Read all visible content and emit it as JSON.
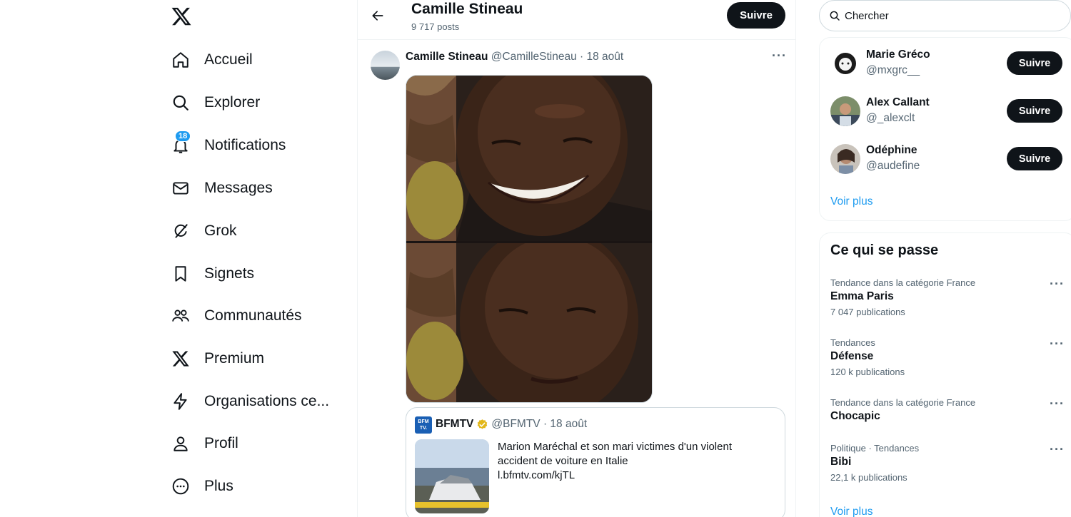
{
  "nav": {
    "items": [
      {
        "label": "Accueil",
        "icon": "home-icon"
      },
      {
        "label": "Explorer",
        "icon": "search-icon"
      },
      {
        "label": "Notifications",
        "icon": "bell-icon",
        "badge": "18"
      },
      {
        "label": "Messages",
        "icon": "mail-icon"
      },
      {
        "label": "Grok",
        "icon": "grok-icon"
      },
      {
        "label": "Signets",
        "icon": "bookmark-icon"
      },
      {
        "label": "Communautés",
        "icon": "communities-icon"
      },
      {
        "label": "Premium",
        "icon": "x-logo-icon"
      },
      {
        "label": "Organisations ce...",
        "icon": "lightning-icon"
      },
      {
        "label": "Profil",
        "icon": "person-icon"
      },
      {
        "label": "Plus",
        "icon": "more-circle-icon"
      }
    ]
  },
  "header": {
    "title": "Camille Stineau",
    "posts_count": "9 717 posts",
    "follow_label": "Suivre"
  },
  "post": {
    "author_name": "Camille Stineau",
    "author_handle": "@CamilleStineau · 18 août",
    "more": "···",
    "quote": {
      "logo_text": "BFM TV.",
      "name": "BFMTV",
      "handle": "@BFMTV · 18 août",
      "text_line1": "Marion Maréchal et son mari victimes d'un violent",
      "text_line2": "accident de voiture en Italie",
      "link": "l.bfmtv.com/kjTL"
    }
  },
  "search": {
    "placeholder": "Chercher"
  },
  "who_to_follow": {
    "users": [
      {
        "name": "Marie Gréco",
        "handle": "@mxgrc__",
        "button": "Suivre"
      },
      {
        "name": "Alex Callant",
        "handle": "@_alexclt",
        "button": "Suivre"
      },
      {
        "name": "Odéphine",
        "handle": "@audefine",
        "button": "Suivre"
      }
    ],
    "see_more": "Voir plus"
  },
  "trends": {
    "title": "Ce qui se passe",
    "items": [
      {
        "context": "Tendance dans la catégorie France",
        "title": "Emma Paris",
        "count": "7 047 publications"
      },
      {
        "context": "Tendances",
        "title": "Défense",
        "count": "120 k publications"
      },
      {
        "context": "Tendance dans la catégorie France",
        "title": "Chocapic",
        "count": ""
      },
      {
        "context": "Politique · Tendances",
        "title": "Bibi",
        "count": "22,1 k publications"
      }
    ],
    "more": "···",
    "see_more": "Voir plus"
  },
  "colors": {
    "accent": "#1d9bf0",
    "text": "#0f1419",
    "secondary": "#536471",
    "button_bg": "#0f1419"
  }
}
